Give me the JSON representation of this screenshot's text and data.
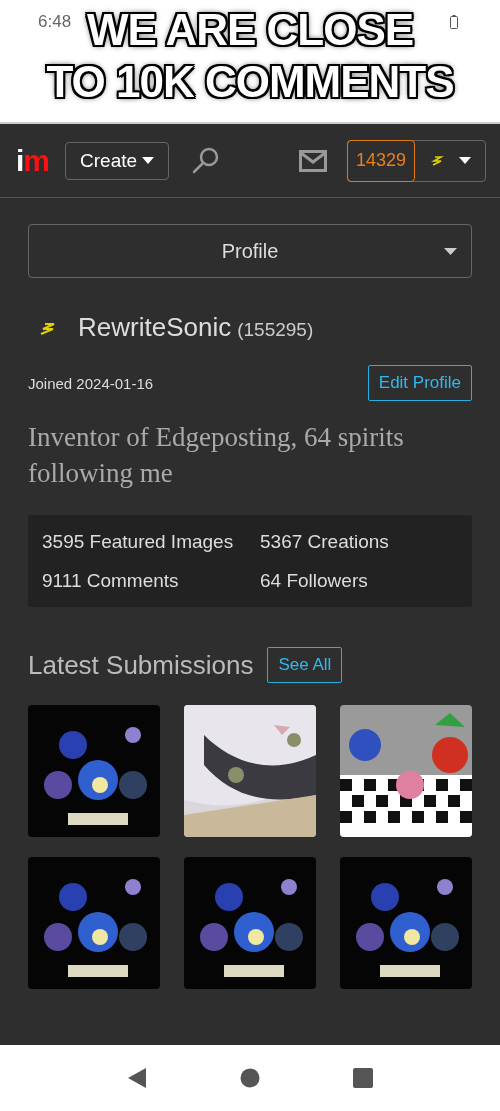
{
  "status_bar": {
    "time": "6:48"
  },
  "caption": [
    "WE ARE CLOSE",
    "TO 10K COMMENTS"
  ],
  "header": {
    "logo": "im",
    "create_label": "Create",
    "points": "14329"
  },
  "profile_select": {
    "value": "Profile"
  },
  "user": {
    "name": "RewriteSonic",
    "score": "(155295)",
    "joined": "Joined 2024-01-16",
    "edit_label": "Edit Profile",
    "bio": "Inventor of Edgeposting, 64 spirits following me"
  },
  "stats": [
    {
      "label": "3595 Featured Images"
    },
    {
      "label": "5367 Creations"
    },
    {
      "label": "9111 Comments"
    },
    {
      "label": "64 Followers"
    }
  ],
  "submissions": {
    "title": "Latest Submissions",
    "see_all_label": "See All"
  }
}
